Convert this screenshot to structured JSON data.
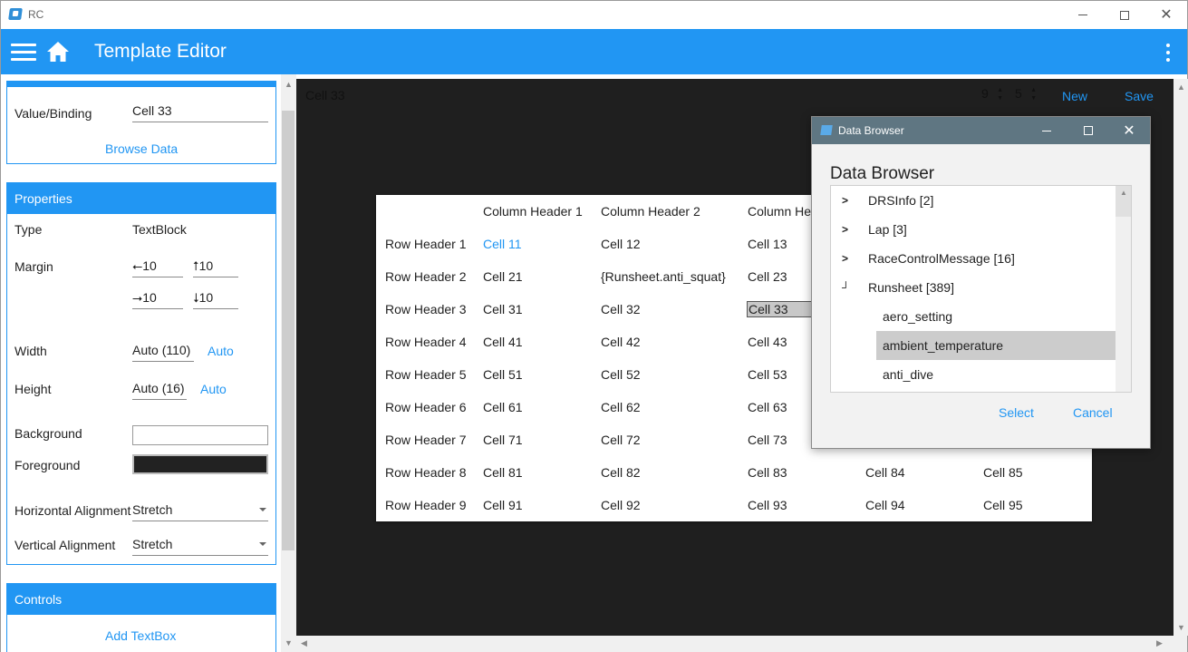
{
  "window": {
    "title": "RC"
  },
  "appbar": {
    "title": "Template Editor"
  },
  "binding_card": {
    "label": "Value/Binding",
    "value": "Cell 33",
    "browse_label": "Browse Data"
  },
  "properties": {
    "header": "Properties",
    "type_label": "Type",
    "type_value": "TextBlock",
    "margin_label": "Margin",
    "margin_left": "10",
    "margin_top": "10",
    "margin_right": "10",
    "margin_bottom": "10",
    "width_label": "Width",
    "width_value": "Auto (110)",
    "width_auto": "Auto",
    "height_label": "Height",
    "height_value": "Auto (16)",
    "height_auto": "Auto",
    "background_label": "Background",
    "foreground_label": "Foreground",
    "halign_label": "Horizontal Alignment",
    "halign_value": "Stretch",
    "valign_label": "Vertical Alignment",
    "valign_value": "Stretch"
  },
  "controls": {
    "header": "Controls",
    "add_textbox": "Add TextBox"
  },
  "canvas": {
    "selected_label": "Cell 33",
    "rows_value": "9",
    "cols_value": "5",
    "new_label": "New",
    "save_label": "Save"
  },
  "table": {
    "column_headers": [
      "Column Header 1",
      "Column Header 2",
      "Column He"
    ],
    "rows": [
      {
        "header": "Row Header 1",
        "cells": [
          "Cell 11",
          "Cell 12",
          "Cell 13"
        ]
      },
      {
        "header": "Row Header 2",
        "cells": [
          "Cell 21",
          "{Runsheet.anti_squat}",
          "Cell 23"
        ]
      },
      {
        "header": "Row Header 3",
        "cells": [
          "Cell 31",
          "Cell 32",
          "Cell 33"
        ]
      },
      {
        "header": "Row Header 4",
        "cells": [
          "Cell 41",
          "Cell 42",
          "Cell 43"
        ]
      },
      {
        "header": "Row Header 5",
        "cells": [
          "Cell 51",
          "Cell 52",
          "Cell 53"
        ]
      },
      {
        "header": "Row Header 6",
        "cells": [
          "Cell 61",
          "Cell 62",
          "Cell 63"
        ]
      },
      {
        "header": "Row Header 7",
        "cells": [
          "Cell 71",
          "Cell 72",
          "Cell 73"
        ]
      },
      {
        "header": "Row Header 8",
        "cells": [
          "Cell 81",
          "Cell 82",
          "Cell 83",
          "Cell 84",
          "Cell 85"
        ]
      },
      {
        "header": "Row Header 9",
        "cells": [
          "Cell 91",
          "Cell 92",
          "Cell 93",
          "Cell 94",
          "Cell 95"
        ]
      }
    ]
  },
  "dialog": {
    "window_title": "Data Browser",
    "heading": "Data Browser",
    "items": [
      {
        "label": "DRSInfo [2]"
      },
      {
        "label": "Lap [3]"
      },
      {
        "label": "RaceControlMessage [16]"
      },
      {
        "label": "Runsheet [389]"
      },
      {
        "label": "aero_setting"
      },
      {
        "label": "ambient_temperature"
      },
      {
        "label": "anti_dive"
      }
    ],
    "select_label": "Select",
    "cancel_label": "Cancel"
  }
}
